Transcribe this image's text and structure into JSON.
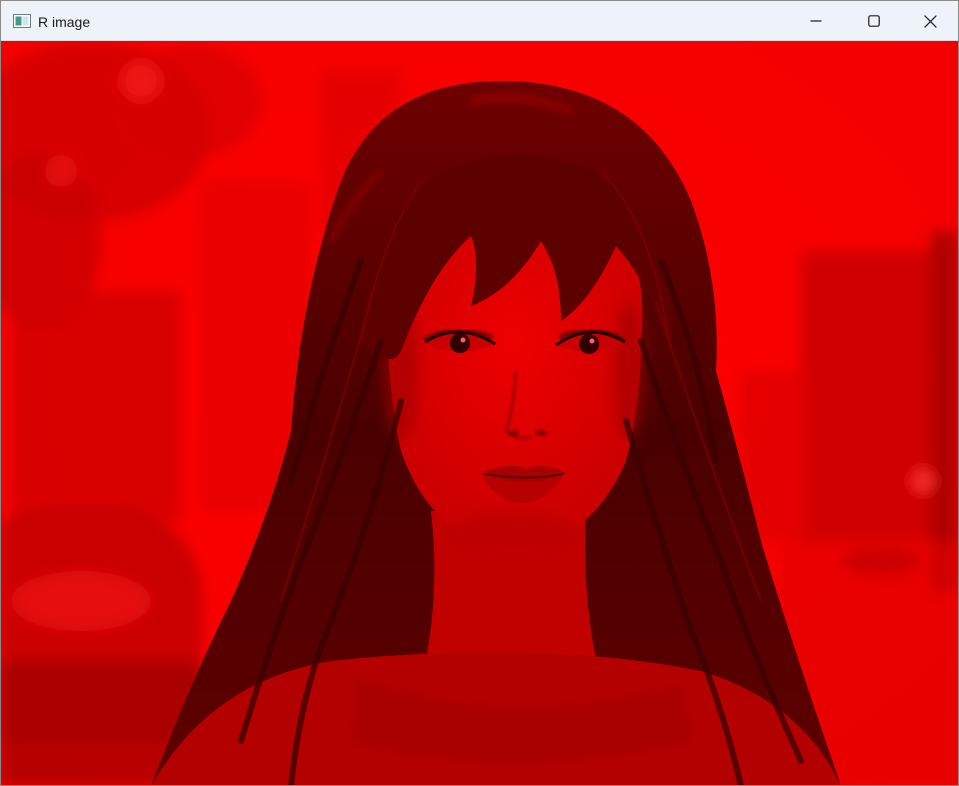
{
  "window": {
    "title": "R image",
    "icon": "opencv-window-icon",
    "controls": {
      "minimize": "minimize-icon",
      "maximize": "maximize-icon",
      "close": "close-icon"
    }
  },
  "image": {
    "channel": "R",
    "tint_color": "#ff0000",
    "shadow_color": "#5a0000",
    "titlebar_color": "#eef3fa"
  }
}
